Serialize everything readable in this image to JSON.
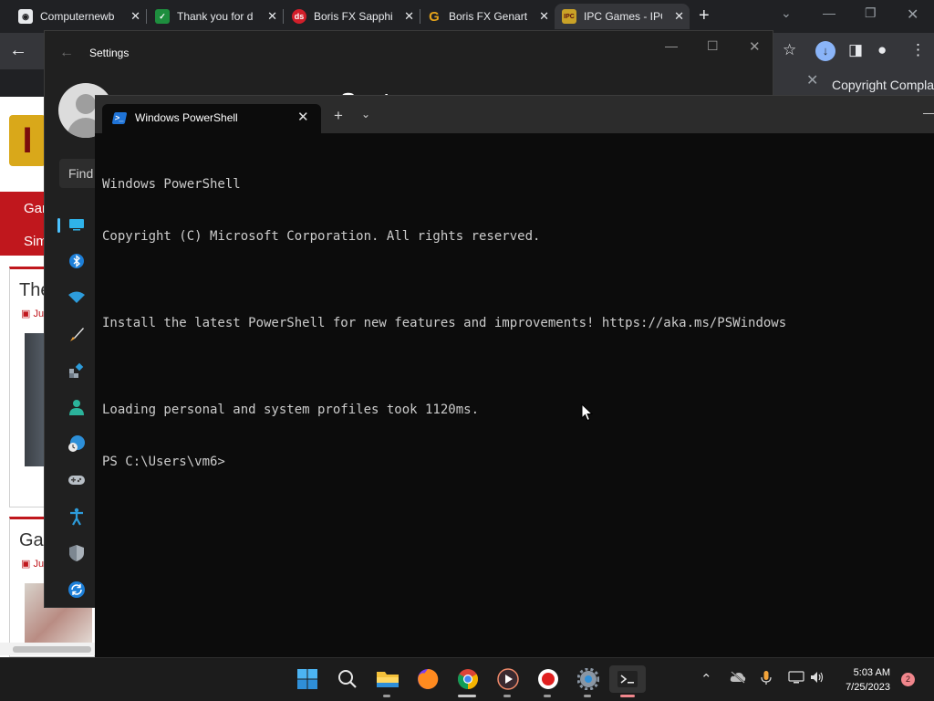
{
  "browser": {
    "tabs": [
      {
        "title": "Computernewb",
        "favicon": "CN"
      },
      {
        "title": "Thank you for d",
        "favicon": "✓"
      },
      {
        "title": "Boris FX Sapphi",
        "favicon": "ds"
      },
      {
        "title": "Boris FX Genart",
        "favicon": "G"
      },
      {
        "title": "IPC Games - IPC",
        "favicon": "IPC"
      }
    ],
    "findbar_text": "Copyright Compla",
    "page": {
      "nav_items": [
        "Gar",
        "Sim"
      ],
      "cards": [
        {
          "title": "The",
          "date": "Ju"
        },
        {
          "title": "Gas",
          "date": "Ju"
        }
      ]
    }
  },
  "settings": {
    "title": "Settings",
    "heading": "System",
    "find_placeholder": "Find",
    "nav_icons": [
      "system-icon",
      "bluetooth-icon",
      "network-icon",
      "personalization-icon",
      "apps-icon",
      "accounts-icon",
      "time-language-icon",
      "gaming-icon",
      "accessibility-icon",
      "privacy-security-icon",
      "windows-update-icon"
    ]
  },
  "terminal": {
    "tab_title": "Windows PowerShell",
    "lines": [
      "Windows PowerShell",
      "Copyright (C) Microsoft Corporation. All rights reserved.",
      "",
      "Install the latest PowerShell for new features and improvements! https://aka.ms/PSWindows",
      "",
      "Loading personal and system profiles took 1120ms.",
      "PS C:\\Users\\vm6>"
    ]
  },
  "taskbar": {
    "apps": [
      "start-icon",
      "search-icon",
      "file-explorer-icon",
      "firefox-icon",
      "chrome-icon",
      "media-player-icon",
      "record-icon",
      "settings-icon",
      "terminal-icon"
    ],
    "time": "5:03 AM",
    "date": "7/25/2023",
    "notification_count": "2"
  },
  "colors": {
    "accent": "#4cc2ff",
    "brand_red": "#c0171d",
    "terminal_bg": "#0c0c0c"
  }
}
